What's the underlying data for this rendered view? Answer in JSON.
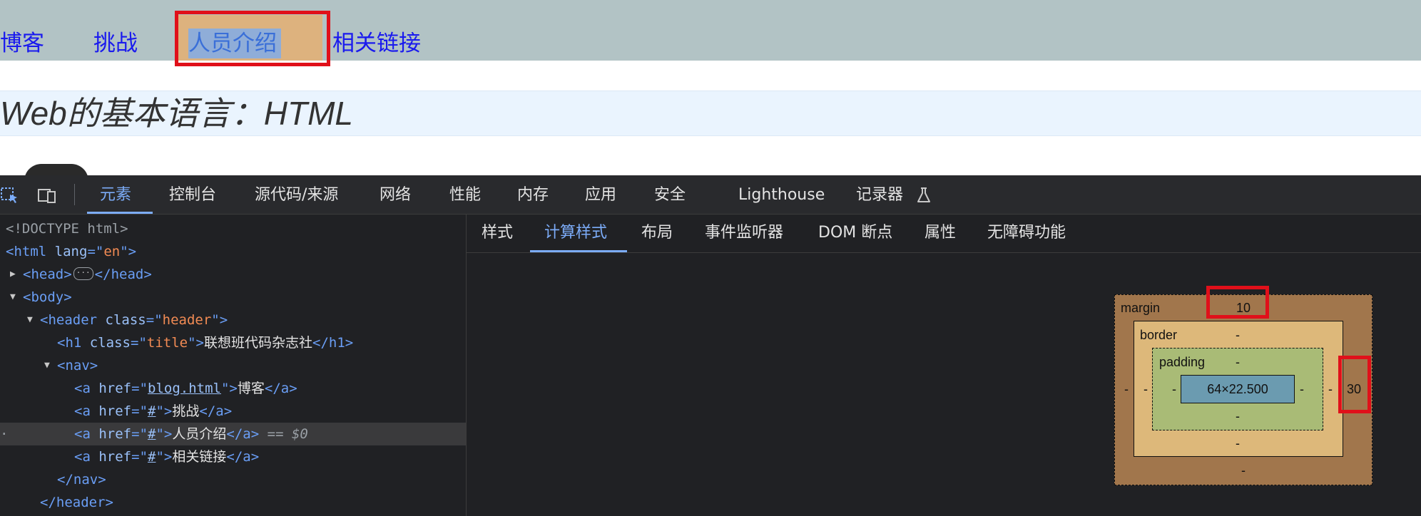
{
  "page": {
    "nav": [
      "博客",
      "挑战",
      "人员介绍",
      "相关链接"
    ],
    "heading": "Web的基本语言：HTML"
  },
  "devtools": {
    "tool_icons": [
      "inspect-element-icon",
      "device-toolbar-icon"
    ],
    "tabs": [
      "元素",
      "控制台",
      "源代码/来源",
      "网络",
      "性能",
      "内存",
      "应用",
      "安全",
      "Lighthouse",
      "记录器"
    ],
    "active_tab": "元素",
    "recorder_icon": "flask-icon",
    "dom": {
      "doctype": "<!DOCTYPE html>",
      "html_tag": "html",
      "html_attr": "lang",
      "html_attr_value": "en",
      "head_tag": "head",
      "body_tag": "body",
      "header_tag": "header",
      "header_attr": "class",
      "header_class": "header",
      "h1_tag": "h1",
      "h1_attr": "class",
      "h1_class": "title",
      "h1_text": "联想班代码杂志社",
      "nav_tag": "nav",
      "link_tag": "a",
      "link_attr": "href",
      "links": [
        {
          "href": "blog.html",
          "text": "博客"
        },
        {
          "href": "#",
          "text": "挑战"
        },
        {
          "href": "#",
          "text": "人员介绍"
        },
        {
          "href": "#",
          "text": "相关链接"
        }
      ],
      "selected_marker": "== $0"
    },
    "side_tabs": [
      "样式",
      "计算样式",
      "布局",
      "事件监听器",
      "DOM 断点",
      "属性",
      "无障碍功能"
    ],
    "active_side_tab": "计算样式",
    "box_model": {
      "margin_label": "margin",
      "border_label": "border",
      "padding_label": "padding",
      "content_size": "64×22.500",
      "margin": {
        "top": "10",
        "right": "30",
        "bottom": "-",
        "left": "-"
      },
      "border": {
        "top": "-",
        "right": "-",
        "bottom": "-",
        "left": "-"
      },
      "padding": {
        "top": "-",
        "right": "-",
        "bottom": "-",
        "left": "-"
      }
    }
  }
}
